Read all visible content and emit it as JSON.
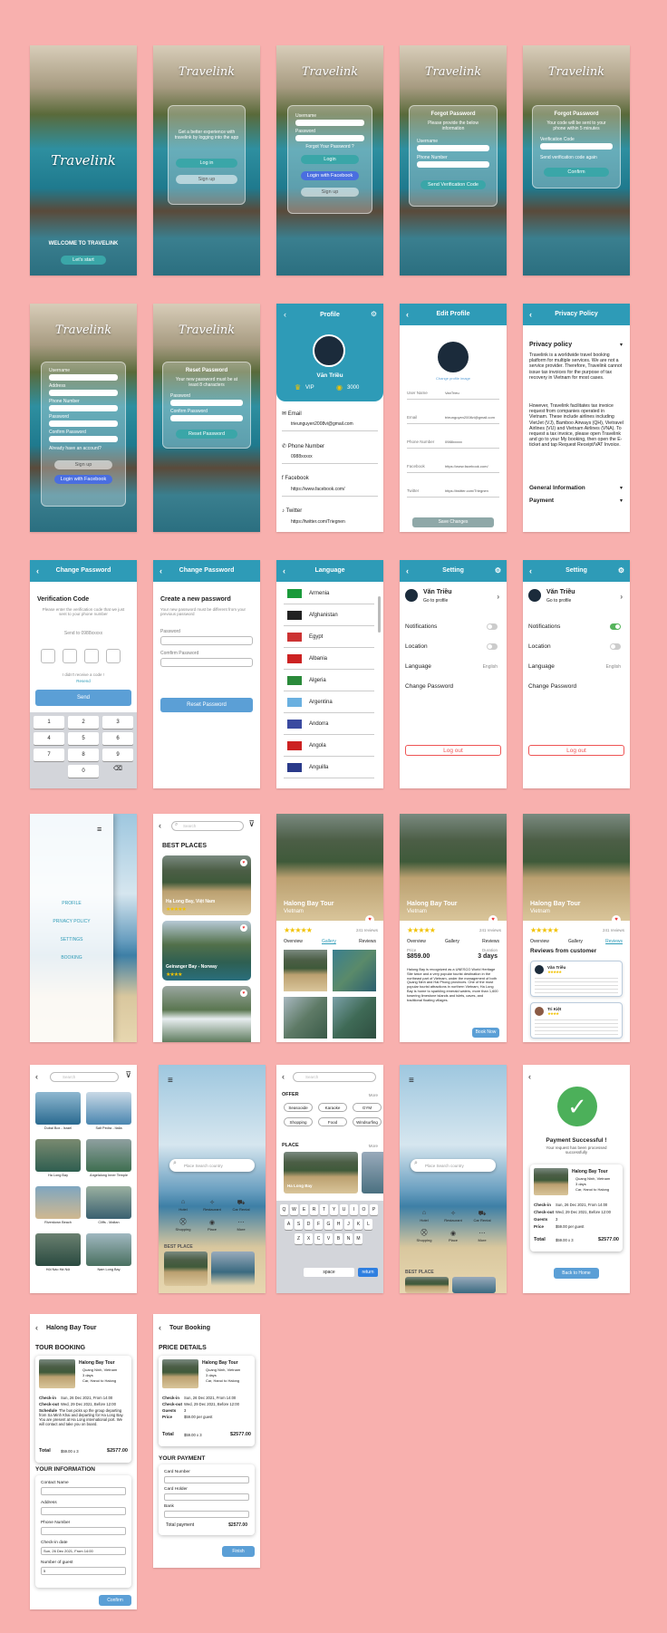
{
  "brand": "Travelink",
  "welcome": {
    "title": "WELCOME TO TRAVELINK",
    "cta": "Let's start"
  },
  "intro": {
    "text": "Get a better experience with travelink by logging into the app",
    "login": "Log in",
    "signup": "Sign up"
  },
  "login": {
    "username": "Username",
    "password": "Password",
    "forgot": "Forgot Your Password ?",
    "login": "Login",
    "facebook": "Login with Facebook",
    "signup": "Sign up"
  },
  "forgot": {
    "title": "Forgot Password",
    "sub": "Please provide the below information",
    "username": "Username",
    "phone": "Phone Number",
    "send": "Send Verification Code"
  },
  "forgot2": {
    "title": "Forgot Password",
    "sub": "Your code will be sent to your phone within 5 minutes",
    "code": "Verification Code",
    "resend": "Send verification code again",
    "confirm": "Confirm"
  },
  "register": {
    "fields": [
      "Username",
      "Address",
      "Phone Number",
      "Password",
      "Confirm Password"
    ],
    "have": "Already have an account?",
    "signup": "Sign up",
    "facebook": "Login with Facebook"
  },
  "reset": {
    "title": "Reset Password",
    "sub": "Your new password must be at least 8 characters",
    "password": "Password",
    "confirm": "Confirm Password",
    "btn": "Reset Password"
  },
  "profile": {
    "title": "Profile",
    "name": "Văn Triều",
    "vip": "VIP",
    "points": "3000",
    "email_label": "Email",
    "email": "trieunguyen2008vi@gmail.com",
    "phone_label": "Phone Number",
    "phone": "0988xxxxx",
    "fb_label": "Facebook",
    "fb": "https://www.facebook.com/",
    "tw_label": "Twitter",
    "tw": "https://twitter.com/Triegnen"
  },
  "edit": {
    "title": "Edit Profile",
    "change": "Change profile image",
    "fields": [
      {
        "k": "User Name",
        "v": "VanTrieu"
      },
      {
        "k": "Email",
        "v": "trieunguyen2008vi@gmail.com"
      },
      {
        "k": "Phone Number",
        "v": "0988xxxxx"
      },
      {
        "k": "Facebook",
        "v": "https://www.facebook.com/"
      },
      {
        "k": "Twitter",
        "v": "https://twitter.com/Triegnen"
      }
    ],
    "save": "Save Changes"
  },
  "privacy": {
    "title": "Privacy Policy",
    "heading": "Privacy policy",
    "p1": "Travelink is a worldwide travel booking platform for multiple services. We are not a service provider. Therefore, Travelink cannot issue tax invoices for the purpose of tax recovery in Vietnam for most cases.",
    "p2": "However, Travelink facilitates tax invoice request from companies operated in Vietnam. These include airlines including VietJet (VJ), Bamboo Airways (QH), Vietravel Airlines (VU) and Vietnam Airlines (VNA). To request a tax invoice, please open Travelink and go to your My booking, then open the E-ticket and tap Request Receipt/VAT Invoice.",
    "s1": "General Information",
    "s2": "Payment"
  },
  "cp1": {
    "title": "Change Password",
    "head": "Verification Code",
    "sub": "Please enter the verification code that we just sent to your phone number",
    "sent": "Send to 0988xxxxx",
    "noreceive": "I didn't receive a code !",
    "resend": "Resend",
    "send": "Send",
    "keys": [
      "1",
      "2",
      "3",
      "4",
      "5",
      "6",
      "7",
      "8",
      "9",
      "0"
    ]
  },
  "cp2": {
    "title": "Change Password",
    "head": "Create a new password",
    "sub": "Your new password must be different from your previous password",
    "password": "Password",
    "confirm": "Comfirm Password",
    "btn": "Reset Password"
  },
  "language": {
    "title": "Language",
    "items": [
      "Armenia",
      "Afghanistan",
      "Egypt",
      "Albania",
      "Algeria",
      "Argentina",
      "Andorra",
      "Angola",
      "Anguilla"
    ]
  },
  "setting": {
    "title": "Setting",
    "name": "Văn Triều",
    "go": "Go to profile",
    "notifications": "Notifications",
    "location": "Location",
    "language": "Language",
    "lang_value": "English",
    "change": "Change Password",
    "logout": "Log out"
  },
  "menu": {
    "items": [
      "PROFILE",
      "PRIVACY POLICY",
      "SETTINGS",
      "BOOKING"
    ]
  },
  "places": {
    "search": "Search",
    "title": "BEST PLACES",
    "cards": [
      {
        "name": "Hạ Long Bay, Việt Nam"
      },
      {
        "name": "Geiranger Bay - Norway"
      },
      {
        "name": ""
      }
    ]
  },
  "halong": {
    "title": "Halong Bay Tour",
    "sub": "Vietnam",
    "reviews": "241 reviews",
    "tabs": [
      "Overview",
      "Gallery",
      "Reviews"
    ],
    "price_label": "Price",
    "price": "$859.00",
    "duration_label": "Duration",
    "duration": "3 days",
    "desc": "Halong Bay is recognized as a UNESCO World Heritage Site twice and a very popular tourist destination in the northeast part of Vietnam, under the management of both Quang Ninh and Hai Phong provinces. One of the most popular tourist attractions in northern Vietnam, Ha Long Bay is home to sparkling emerald waters, more than 1,600 towering limestone islands and islets, caves, and traditional floating villages.",
    "book": "Book Now",
    "rev_title": "Reviews from customer",
    "r1": "Văn Triều",
    "r2": "Tri Kiệt"
  },
  "grid": {
    "search": "Search",
    "items": [
      "Dubai Box - Israel",
      "Salt Pedra - Italia",
      "Ha Long Bay",
      "Angelalong Inner Temple",
      "Riverdown Beach",
      "Cliffs - Maltan",
      "Hội Nào Hà Nội",
      "Nam Long Bay"
    ]
  },
  "home": {
    "search": "Place Search country",
    "cats": [
      "Hotel",
      "Restaurant",
      "Car Rental",
      "Shopping",
      "Place",
      "More"
    ],
    "best": "BEST PLACE"
  },
  "filter": {
    "search": "Search",
    "offer": "OFFER",
    "more": "More",
    "offers": [
      "Seasooide",
      "Karaoke",
      "GYM",
      "Shopping",
      "Food",
      "Windsurfing"
    ],
    "place": "PLACE",
    "card": "Ha Long Bay",
    "space": "space",
    "enter": "return"
  },
  "payment": {
    "title": "Payment Successful !",
    "sub": "Your request has been processed successfully",
    "tour": "Halong Bay Tour",
    "loc": "Quang Ninh, Vietnam",
    "days": "3 days",
    "car": "Car, Hanoi to Halong",
    "in": "Sun, 26 Dec 2021, From 14:00",
    "out": "Wed, 29 Dec 2021, Before 12:00",
    "guests": "3",
    "price": "$59.00 per guest",
    "total": "$2577.00",
    "calc": "$59.00 x 3",
    "back": "Back to Home"
  },
  "booking": {
    "title": "Halong Bay Tour",
    "head": "TOUR BOOKING",
    "schedule": "The bus picks up the group departing from Sa Minh Khai and departing for Ha Long Bay. You are present at Ha Long international port. We will contact and take you on board.",
    "info": "YOUR INFORMATION",
    "fields": [
      "Contact Name",
      "Address",
      "Phone Number",
      "Check-in date",
      "Number of guest"
    ],
    "date": "Sun, 26 Dec 2021, From 14:00",
    "guests": "5",
    "confirm": "Confirm"
  },
  "tourbook": {
    "title": "Tour Booking",
    "head": "PRICE DETAILS",
    "pay": "YOUR PAYMENT",
    "fields": [
      "Card Number",
      "Card Holder",
      "Bank"
    ],
    "total_label": "Total payment",
    "total": "$2577.00",
    "finish": "Finish"
  },
  "labels": {
    "checkin": "Check-in",
    "checkout": "Check-out",
    "guests": "Guests",
    "price": "Price",
    "total": "Total",
    "schedule": "Schedule"
  }
}
